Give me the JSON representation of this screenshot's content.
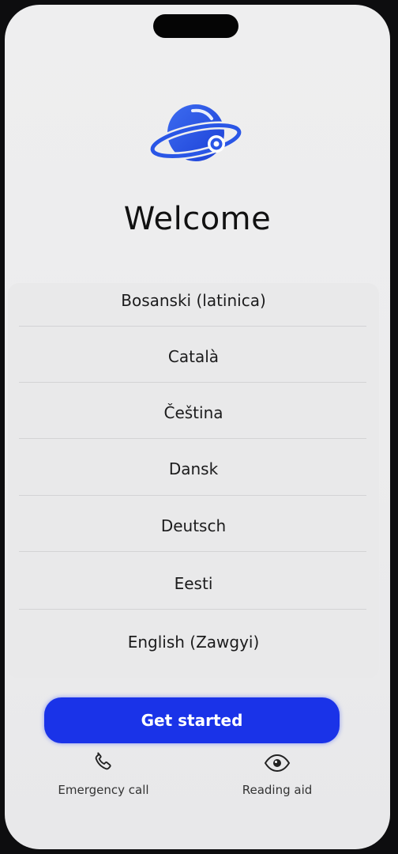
{
  "welcome": {
    "title": "Welcome"
  },
  "languages": [
    "Bosanski (latinica)",
    "Català",
    "Čeština",
    "Dansk",
    "Deutsch",
    "Eesti",
    "English (Zawgyi)"
  ],
  "actions": {
    "get_started": "Get started",
    "emergency_call": "Emergency call",
    "reading_aid": "Reading aid"
  },
  "icons": {
    "logo": "planet-orbit-icon",
    "emergency": "phone-icon",
    "reading": "eye-icon"
  },
  "colors": {
    "primary": "#1a33e8",
    "logo_blue": "#2a56e6"
  }
}
